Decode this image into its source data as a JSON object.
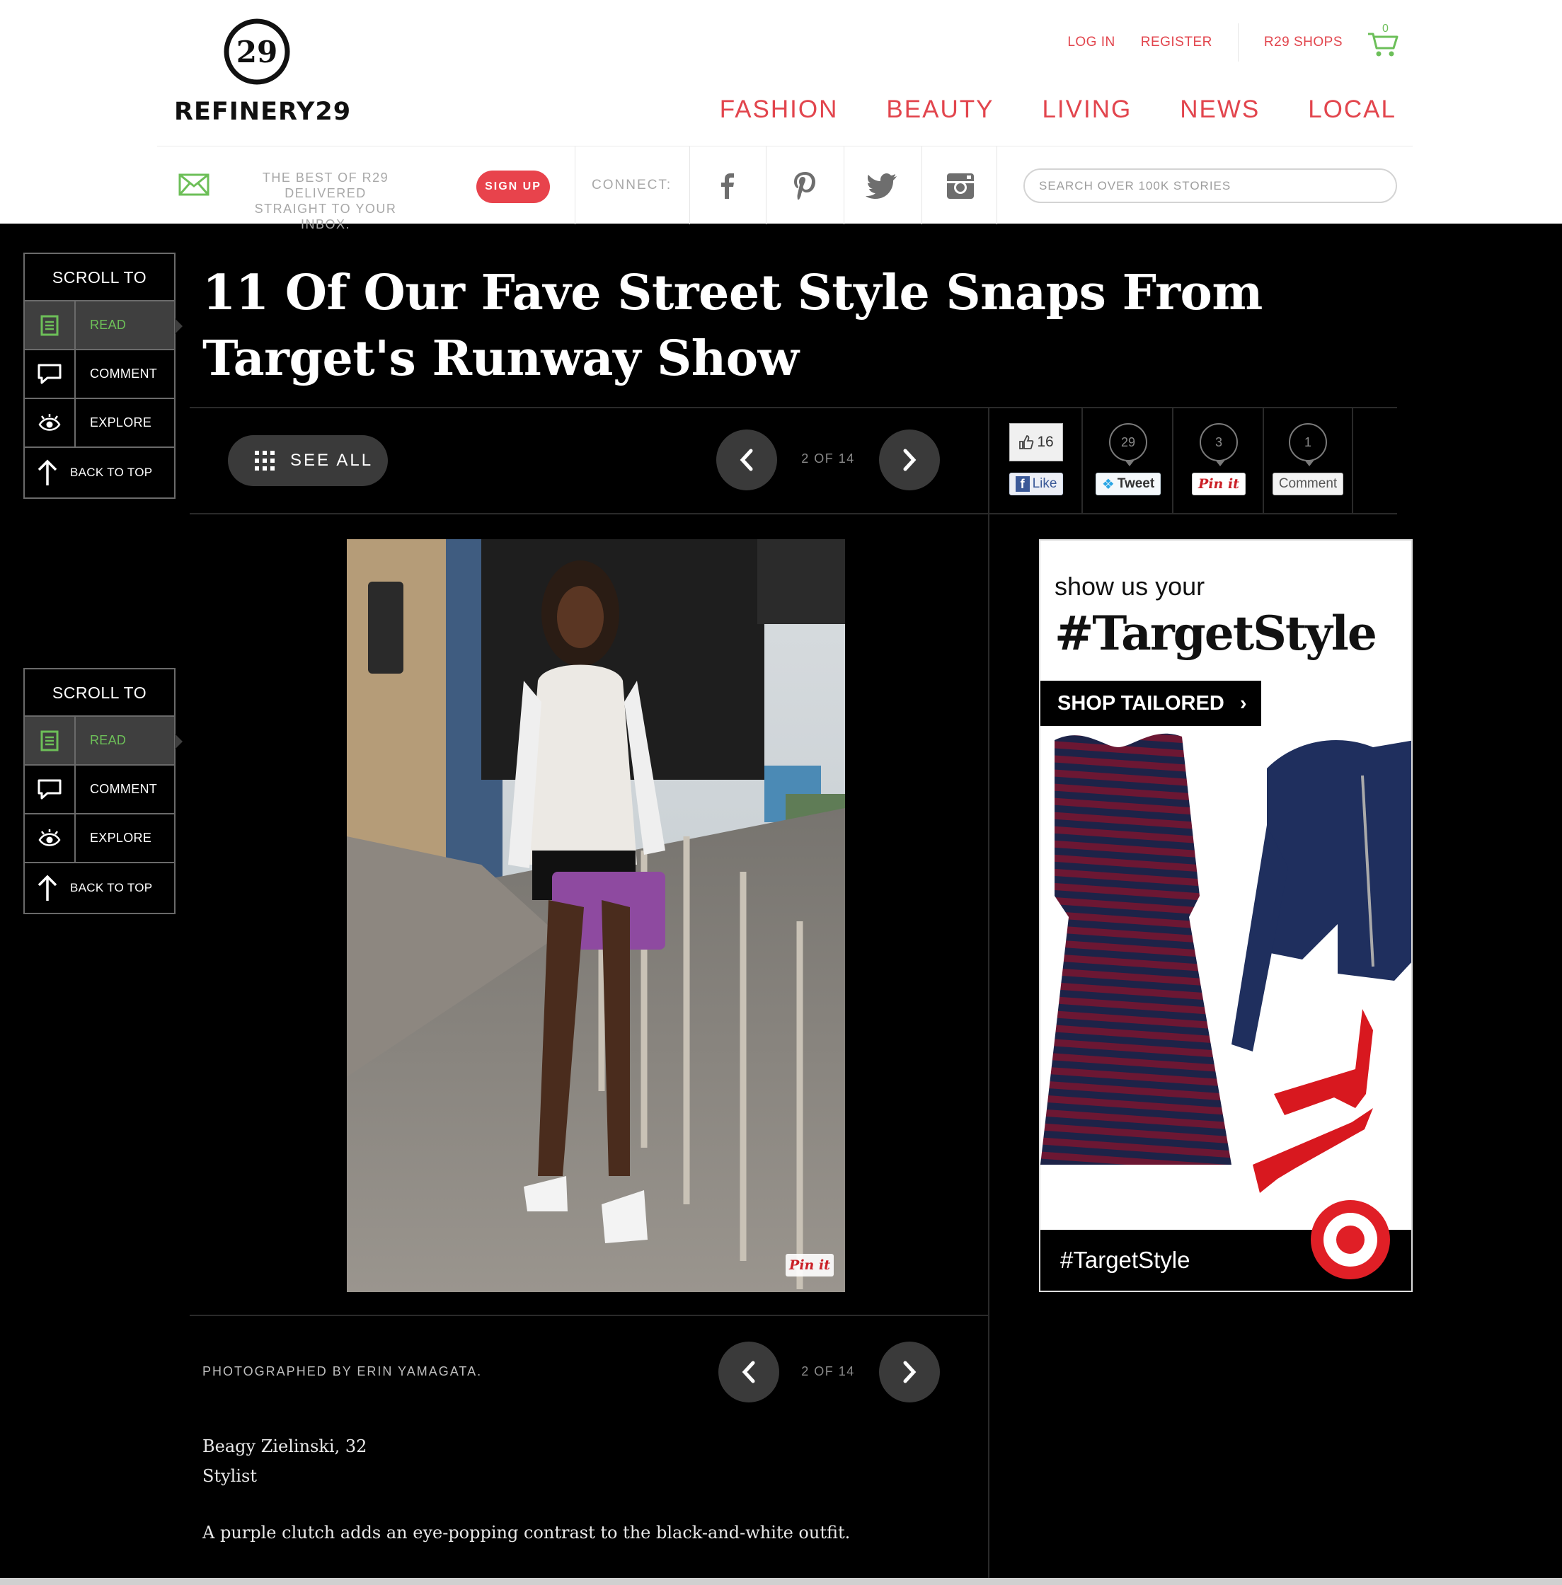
{
  "brand": {
    "name": "REFINERY29",
    "mark": "29"
  },
  "utility_nav": {
    "login": "LOG IN",
    "register": "REGISTER",
    "shops": "R29 SHOPS",
    "cart_count": "0"
  },
  "main_nav": [
    "FASHION",
    "BEAUTY",
    "LIVING",
    "NEWS",
    "LOCAL"
  ],
  "newsletter": {
    "line1": "THE BEST OF R29 DELIVERED",
    "line2": "STRAIGHT TO YOUR INBOX.",
    "signup": "SIGN UP"
  },
  "connect_label": "CONNECT:",
  "social_icons": [
    "facebook-icon",
    "pinterest-icon",
    "twitter-icon",
    "instagram-icon"
  ],
  "search": {
    "placeholder": "SEARCH OVER 100K STORIES",
    "value": ""
  },
  "scroll_to": {
    "heading": "SCROLL TO",
    "items": [
      {
        "label": "READ",
        "icon": "document-icon",
        "active": true
      },
      {
        "label": "COMMENT",
        "icon": "comment-icon",
        "active": false
      },
      {
        "label": "EXPLORE",
        "icon": "eye-icon",
        "active": false
      },
      {
        "label": "BACK TO TOP",
        "icon": "arrow-up-icon",
        "active": false
      }
    ]
  },
  "article": {
    "title": "11 Of Our Fave Street Style Snaps From Target's Runway Show",
    "see_all": "SEE ALL",
    "pager": "2 OF 14",
    "credit": "PHOTOGRAPHED BY ERIN YAMAGATA.",
    "caption_name": "Beagy Zielinski, 32",
    "caption_role": "Stylist",
    "caption_text": "A purple clutch adds an eye-popping contrast to the black-and-white outfit.",
    "photo_pin": "Pin it"
  },
  "share": {
    "facebook": {
      "count": "16",
      "label": "Like"
    },
    "twitter": {
      "count": "29",
      "label": "Tweet"
    },
    "pinterest": {
      "count": "3",
      "label": "Pin it"
    },
    "comment": {
      "count": "1",
      "label": "Comment"
    }
  },
  "ad": {
    "line1": "show us your",
    "hashtag": "#TargetStyle",
    "cta": "SHOP TAILORED",
    "footer": "#TargetStyle"
  },
  "colors": {
    "brand_red": "#e2454d",
    "green": "#6dbf58",
    "background": "#000000"
  }
}
